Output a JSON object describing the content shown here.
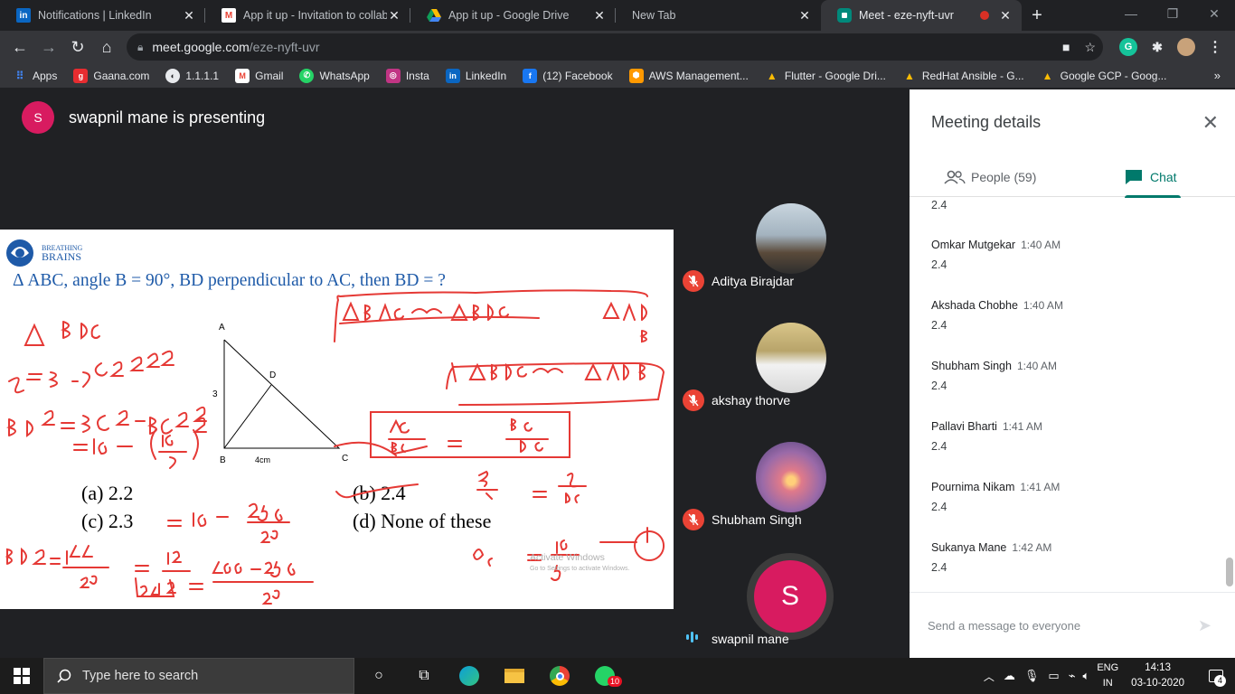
{
  "browser": {
    "tabs": [
      {
        "title": "Notifications | LinkedIn",
        "favicon": "linkedin-icon",
        "active": false
      },
      {
        "title": "App it up - Invitation to collab",
        "favicon": "gmail-icon",
        "active": false
      },
      {
        "title": "App it up - Google Drive",
        "favicon": "drive-icon",
        "active": false
      },
      {
        "title": "New Tab",
        "favicon": "",
        "active": false
      },
      {
        "title": "Meet - eze-nyft-uvr",
        "favicon": "meet-icon",
        "active": true
      }
    ],
    "url_host": "meet.google.com",
    "url_path": "/eze-nyft-uvr",
    "bookmarks": [
      {
        "label": "Apps",
        "icon": "apps-grid-icon",
        "color": "#4285f4"
      },
      {
        "label": "Gaana.com",
        "icon": "gaana-icon",
        "color": "#e72c30"
      },
      {
        "label": "1.1.1.1",
        "icon": "cloudflare-icon",
        "color": "#5f6368"
      },
      {
        "label": "Gmail",
        "icon": "gmail-icon",
        "color": "#ea4335"
      },
      {
        "label": "WhatsApp",
        "icon": "whatsapp-icon",
        "color": "#25d366"
      },
      {
        "label": "Insta",
        "icon": "instagram-icon",
        "color": "#c13584"
      },
      {
        "label": "LinkedIn",
        "icon": "linkedin-icon",
        "color": "#0a66c2"
      },
      {
        "label": "(12) Facebook",
        "icon": "facebook-icon",
        "color": "#1877f2"
      },
      {
        "label": "AWS Management...",
        "icon": "aws-icon",
        "color": "#ff9900"
      },
      {
        "label": "Flutter - Google Dri...",
        "icon": "drive-icon",
        "color": "#fbbc04"
      },
      {
        "label": "RedHat Ansible - G...",
        "icon": "drive-icon",
        "color": "#fbbc04"
      },
      {
        "label": "Google GCP - Goog...",
        "icon": "drive-icon",
        "color": "#fbbc04"
      }
    ]
  },
  "meet": {
    "presenter_initial": "S",
    "presenter_text": "swapnil mane is presenting",
    "slide": {
      "brand_top": "BREATHING",
      "brand_bottom": "BRAINS",
      "question": "Δ ABC, angle B = 90°, BD perpendicular to AC, then BD = ?",
      "options": [
        "(a) 2.2",
        "(b) 2.4",
        "(c) 2.3",
        "(d) None of these"
      ],
      "label_A": "A",
      "label_B": "B",
      "label_C": "C",
      "label_D": "D",
      "label_3": "3",
      "label_4cm": "4cm",
      "watermark_1": "Activate Windows",
      "watermark_2": "Go to Settings to activate Windows."
    },
    "participants": [
      {
        "name": "Aditya Birajdar",
        "muted": true
      },
      {
        "name": "akshay thorve",
        "muted": true
      },
      {
        "name": "Shubham Singh",
        "muted": true
      },
      {
        "name": "swapnil mane",
        "muted": false,
        "initial": "S"
      }
    ]
  },
  "panel": {
    "title": "Meeting details",
    "people_tab": "People (59)",
    "chat_tab": "Chat",
    "partial_top": "2.4",
    "messages": [
      {
        "who": "Omkar Mutgekar",
        "time": "1:40 AM",
        "text": "2.4"
      },
      {
        "who": "Akshada Chobhe",
        "time": "1:40 AM",
        "text": "2.4"
      },
      {
        "who": "Shubham Singh",
        "time": "1:40 AM",
        "text": "2.4"
      },
      {
        "who": "Pallavi Bharti",
        "time": "1:41 AM",
        "text": "2.4"
      },
      {
        "who": "Pournima Nikam",
        "time": "1:41 AM",
        "text": "2.4"
      },
      {
        "who": "Sukanya Mane",
        "time": "1:42 AM",
        "text": "2.4"
      }
    ],
    "composer_placeholder": "Send a message to everyone"
  },
  "taskbar": {
    "search_placeholder": "Type here to search",
    "whatsapp_badge": "10",
    "lang_top": "ENG",
    "lang_bottom": "IN",
    "time": "14:13",
    "date": "03-10-2020",
    "notification_count": "4"
  }
}
